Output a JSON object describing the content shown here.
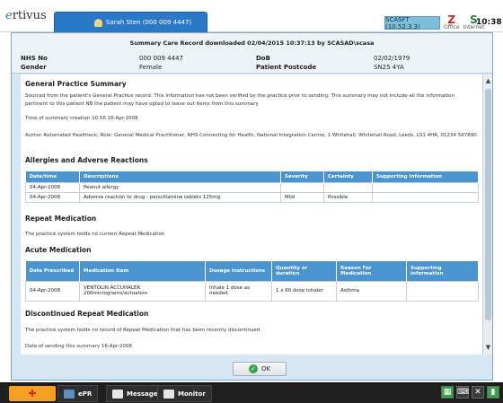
{
  "topbar": {
    "brand_prefix": "e",
    "brand_name": "rtivus",
    "user_tab": "Sarah Sten (000 009 4447)",
    "unit": "SCASFT (10.52.3.3)",
    "status_icons": [
      {
        "name": "zoll-icon",
        "caption": "Office",
        "glyph": "Z"
      },
      {
        "name": "internet-icon",
        "caption": "Internet",
        "glyph": "S"
      }
    ],
    "time": "10:38"
  },
  "summary_header": {
    "title": "Summary Care Record downloaded 02/04/2015 10:37:13 by SCASAD\\scasa",
    "nhs_label": "NHS No",
    "nhs_value": "000 009 4447",
    "dob_label": "DoB",
    "dob_value": "02/02/1979",
    "gender_label": "Gender",
    "gender_value": "Female",
    "postcode_label": "Patient Postcode",
    "postcode_value": "SN25 4YA"
  },
  "gp_summary": {
    "heading": "General Practice Summary",
    "intro": "Sourced from the patient's General Practice record. This information has not been verified by the practice prior to sending. This summary may not include all the information pertinent to this patient NB the patient may have opted to leave out items from this summary",
    "time_created": "Time of summary creation 10.56 16-Apr-2008",
    "author": "Author Automated Healtheck, Role: General Medical Practitioner, NHS Connecting for Health, National Integration Centre, 1 Whitehall, Whitehall Road, Leeds, LS1 4HR, 01234 567890"
  },
  "allergies": {
    "heading": "Allergies and Adverse Reactions",
    "columns": [
      "Date/time",
      "Descriptions",
      "Severity",
      "Certainty",
      "Supporting Information"
    ],
    "rows": [
      [
        "04-Apr-2008",
        "Peanut allergy",
        "",
        "",
        ""
      ],
      [
        "04-Apr-2008",
        "Adverse reaction to drug - penicillamine tablets 125mg",
        "Mild",
        "Possible",
        ""
      ]
    ]
  },
  "repeat_medication": {
    "heading": "Repeat Medication",
    "text": "The practice system holds no current Repeat Medication"
  },
  "acute_medication": {
    "heading": "Acute Medication",
    "columns": [
      "Date Prescribed",
      "Medication Item",
      "Dosage Instructions",
      "Quantity or duration",
      "Reason For Medication",
      "Supporting Information"
    ],
    "rows": [
      [
        "04-Apr-2008",
        "VENTOLIN ACCUHALER 200micrograms/actuation",
        "Inhale 1 dose as needed",
        "1 x 60 dose inhaler",
        "Asthma",
        ""
      ]
    ]
  },
  "discontinued": {
    "heading": "Discontinued Repeat Medication",
    "text": "The practice system holds no record of Repeat Medication that has been recently discontinued",
    "date_sent": "Date of sending this summary 16-Apr-2008"
  },
  "dialog": {
    "ok_label": "OK"
  },
  "taskbar": {
    "epr_label": "ePR",
    "messages_label": "Messages",
    "monitor_label": "Monitor"
  }
}
